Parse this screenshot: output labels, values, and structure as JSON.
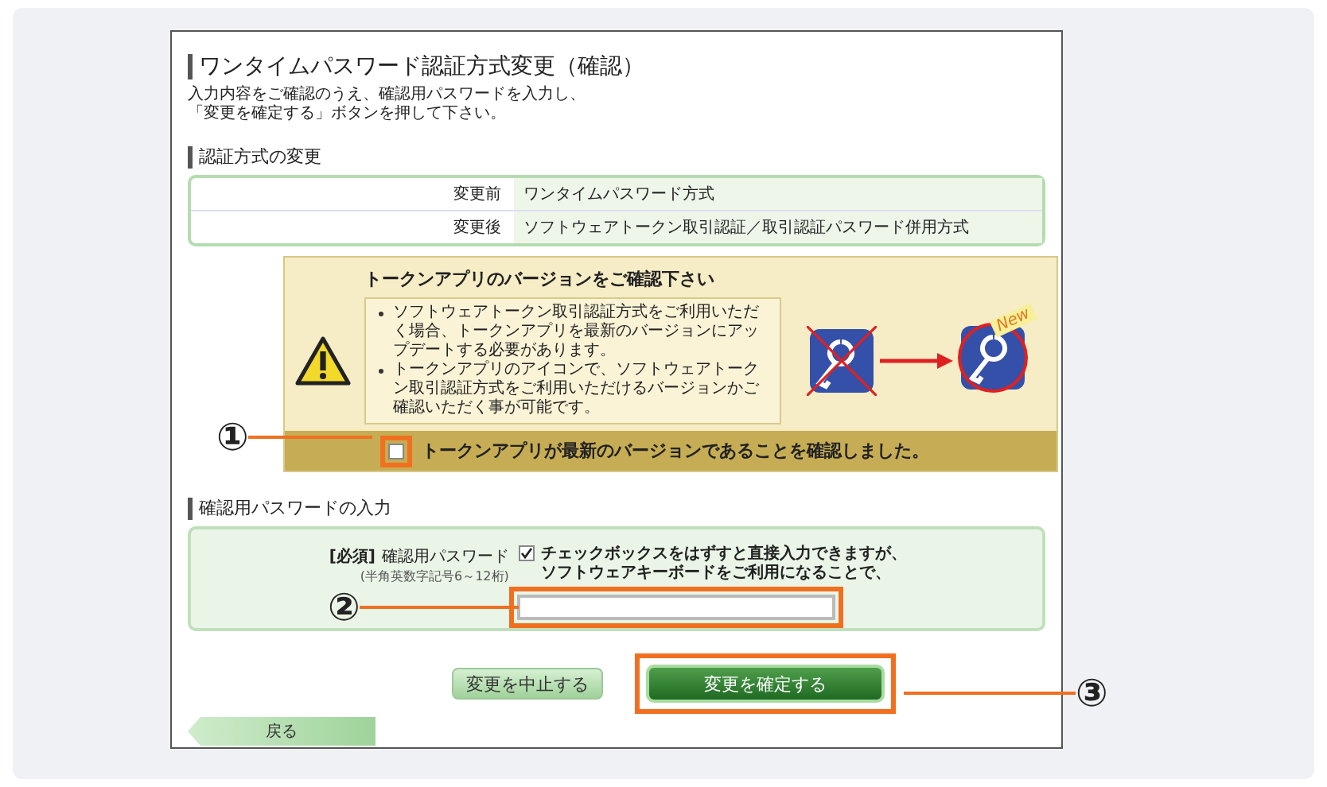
{
  "title": "ワンタイムパスワード認証方式変更（確認）",
  "instructions": [
    "入力内容をご確認のうえ、確認用パスワードを入力し、",
    "「変更を確定する」ボタンを押して下さい。"
  ],
  "auth_section": {
    "heading": "認証方式の変更",
    "rows": [
      {
        "label": "変更前",
        "value": "ワンタイムパスワード方式"
      },
      {
        "label": "変更後",
        "value": "ソフトウェアトークン取引認証／取引認証パスワード併用方式"
      }
    ]
  },
  "notice": {
    "title": "トークンアプリのバージョンをご確認下さい",
    "bullets": [
      "ソフトウェアトークン取引認証方式をご利用いただく場合、トークンアプリを最新のバージョンにアップデートする必要があります。",
      "トークンアプリのアイコンで、ソフトウェアトークン取引認証方式をご利用いただけるバージョンかご確認いただく事が可能です。"
    ],
    "badge": "New",
    "confirm": {
      "label": "トークンアプリが最新のバージョンであることを確認しました。",
      "checked": false
    }
  },
  "password_section": {
    "heading": "確認用パスワードの入力",
    "required": "[必須]",
    "label": "確認用パスワード",
    "hint": "(半角英数字記号6～12桁)",
    "keyboard": {
      "checked": true,
      "lines": [
        "チェックボックスをはずすと直接入力できますが、",
        "ソフトウェアキーボードをご利用になることで、"
      ]
    }
  },
  "buttons": {
    "cancel": "変更を中止する",
    "confirm": "変更を確定する",
    "back": "戻る"
  },
  "callouts": [
    "①",
    "②",
    "③"
  ]
}
